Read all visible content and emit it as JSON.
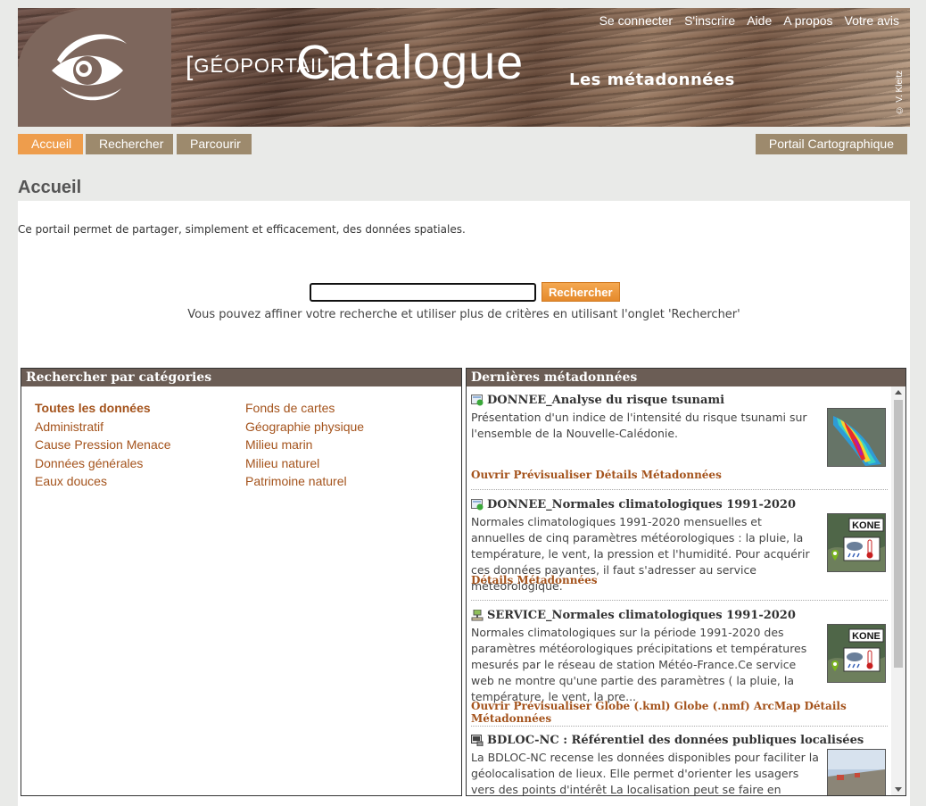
{
  "header": {
    "links": [
      "Se connecter",
      "S'inscrire",
      "Aide",
      "A propos",
      "Votre avis"
    ],
    "geo_label": "GÉOPORTAIL",
    "title": "Catalogue",
    "subtitle": "Les métadonnées",
    "credit": "© V. Kleitz"
  },
  "nav": {
    "tabs": [
      "Accueil",
      "Rechercher",
      "Parcourir"
    ],
    "right_tab": "Portail Cartographique",
    "active_index": 0,
    "active_color": "#ee9d4c",
    "tab_color": "#9d8a6d"
  },
  "page": {
    "title": "Accueil",
    "intro": "Ce portail permet de partager, simplement et efficacement, des données spatiales.",
    "search_button": "Rechercher",
    "search_value": "",
    "hint": "Vous pouvez affiner votre recherche et utiliser plus de critères en utilisant l'onglet 'Rechercher'"
  },
  "categories": {
    "title": "Rechercher par catégories",
    "col1": [
      "Toutes les données",
      "Administratif",
      "Cause Pression Menace",
      "Données générales",
      "Eaux douces"
    ],
    "col2": [
      "Fonds de cartes",
      "Géographie physique",
      "Milieu marin",
      "Milieu naturel",
      "Patrimoine naturel"
    ]
  },
  "latest": {
    "title": "Dernières métadonnées",
    "items": [
      {
        "title": "DONNEE_Analyse du risque tsunami",
        "icon": "layer-data-icon",
        "desc": "Présentation d'un indice de l'intensité du risque tsunami sur l'ensemble de la Nouvelle-Calédonie.",
        "links": "Ouvrir Prévisualiser Détails Métadonnées"
      },
      {
        "title": "DONNEE_Normales climatologiques 1991-2020",
        "icon": "layer-data-icon",
        "desc": "Normales climatologiques 1991-2020 mensuelles et annuelles de cinq paramètres météorologiques : la pluie, la température, le vent, la pression et l'humidité. Pour acquérir ces données payantes, il faut s'adresser au service météorologique.",
        "links": "Détails Métadonnées",
        "thumb_label": "KONE"
      },
      {
        "title": "SERVICE_Normales climatologiques 1991-2020",
        "icon": "service-icon",
        "desc": "Normales climatologiques sur la période 1991-2020 des paramètres météorologiques précipitations et températures mesurés par le réseau de station Météo-France.Ce service web ne montre qu'une partie des paramètres ( la pluie, la température, le vent, la pre...",
        "links": "Ouvrir Prévisualiser Globe (.kml) Globe (.nmf) ArcMap Détails Métadonnées",
        "thumb_label": "KONE"
      },
      {
        "title": "BDLOC-NC : Référentiel des données publiques localisées",
        "icon": "dataset-icon",
        "desc": "La BDLOC-NC recense les données disponibles pour faciliter la géolocalisation de lieux. Elle permet d'orienter les usagers vers des points d'intérêt La localisation peut se faire en fonction de"
      }
    ]
  }
}
